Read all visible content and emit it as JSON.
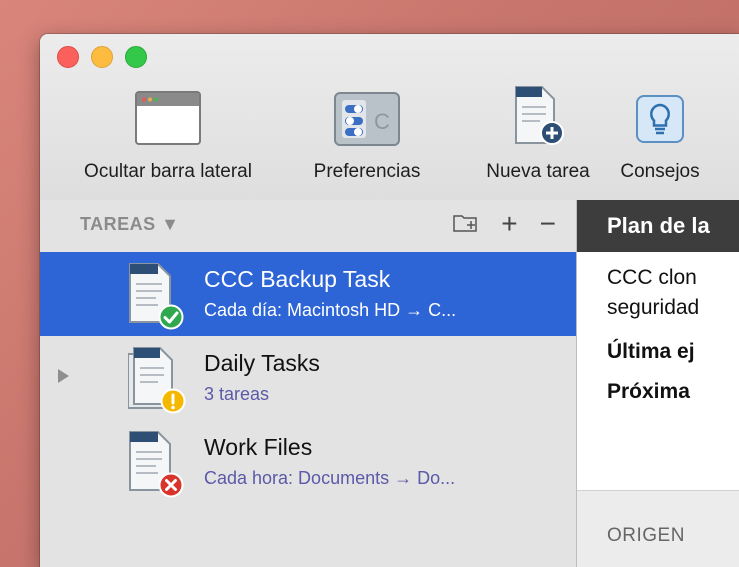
{
  "toolbar": {
    "items": [
      {
        "label": "Ocultar barra lateral",
        "icon": "sidebar-window-icon"
      },
      {
        "label": "Preferencias",
        "icon": "preferences-toggle-icon"
      },
      {
        "label": "Nueva tarea",
        "icon": "new-task-document-icon"
      },
      {
        "label": "Consejos",
        "icon": "lightbulb-icon"
      }
    ]
  },
  "sidebar": {
    "title": "TAREAS ▼",
    "actions": {
      "folder": "folder-add-icon",
      "add": "+",
      "remove": "−"
    },
    "tasks": [
      {
        "name": "CCC Backup Task",
        "subtitle": "Cada día: Macintosh HD → C...",
        "status": "success",
        "selected": true
      },
      {
        "name": "Daily Tasks",
        "subtitle": "3 tareas",
        "status": "warning",
        "selected": false
      },
      {
        "name": "Work Files",
        "subtitle": "Cada hora: Documents → Do...",
        "status": "error",
        "selected": false
      }
    ]
  },
  "content": {
    "header": "Plan de la",
    "line1": "CCC clon",
    "line2": "seguridad",
    "last_run": "Última ej",
    "next_run": "Próxima",
    "origin_label": "ORIGEN"
  },
  "colors": {
    "selection": "#2d64d6",
    "subtitle": "#5b59a8",
    "success": "#2fa84f",
    "warning": "#f5b800",
    "error": "#d9342b"
  }
}
